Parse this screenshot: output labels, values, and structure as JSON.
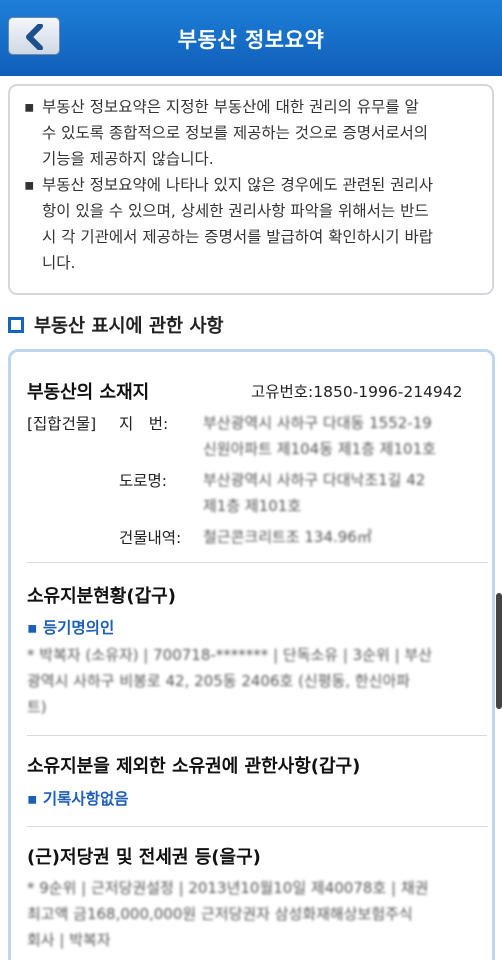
{
  "header": {
    "title": "부동산 정보요약",
    "back_icon": "chevron-left-icon"
  },
  "notice": {
    "items": [
      {
        "lines": [
          "부동산 정보요약은 지정한 부동산에 대한 권리의 유무를 알",
          "수 있도록 종합적으로 정보를 제공하는 것으로 증명서로서의",
          "기능을 제공하지 않습니다."
        ]
      },
      {
        "lines": [
          "부동산 정보요약에 나타나 있지 않은 경우에도 관련된 권리사",
          "항이 있을 수 있으며, 상세한 권리사항 파악을 위해서는 반드",
          "시 각 기관에서 제공하는 증명서를 발급하여 확인하시기 바랍",
          "니다."
        ]
      }
    ]
  },
  "section_title": "부동산 표시에 관한 사항",
  "location": {
    "title": "부동산의 소재지",
    "unique_number": "고유번호:1850-1996-214942",
    "type_label": "[집합건물]",
    "lot_label": "지　번:",
    "lot_value": [
      "부산광역시 사하구 다대동 1552-19",
      "신원아파트 제104동 제1층 제101호"
    ],
    "road_label": "도로명:",
    "road_value": [
      "부산광역시 사하구 다대낙조1길 42",
      "제1층 제101호"
    ],
    "building_label": "건물내역:",
    "building_value": "철근콘크리트조 134.96㎡"
  },
  "ownership": {
    "title": "소유지분현황(갑구)",
    "sub_label": "등기명의인",
    "lines": [
      "* 박복자 (소유자) | 700718-******* | 단독소유 | 3순위 | 부산",
      "광역시 사하구 비봉로 42, 205동 2406호 (신평동, 한신아파",
      "트)"
    ]
  },
  "other_ownership": {
    "title": "소유지분을 제외한 소유권에 관한사항(갑구)",
    "sub_label": "기록사항없음"
  },
  "mortgage": {
    "title": "(근)저당권 및 전세권 등(을구)",
    "lines": [
      "* 9순위 | 근저당권설정 | 2013년10월10일 제40078호 | 채권",
      "최고액 금168,000,000원 근저당권자 삼성화재해상보험주식",
      "회사 | 박복자"
    ]
  },
  "colors": {
    "header_bg": "#1565c0",
    "accent": "#1d5fb8",
    "panel_border": "#bfd7ec"
  }
}
